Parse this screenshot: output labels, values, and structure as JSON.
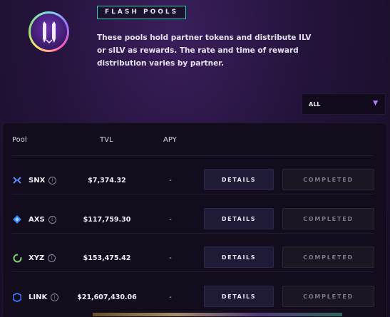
{
  "header": {
    "badge": "FLASH POOLS",
    "description": "These pools hold partner tokens and distribute ILV or sILV as rewards. The rate and time of reward distribution varies by partner."
  },
  "filter": {
    "selected": "ALL"
  },
  "table": {
    "columns": {
      "pool": "Pool",
      "tvl": "TVL",
      "apy": "APY"
    },
    "rows": [
      {
        "token": "SNX",
        "tvl": "$7,374.32",
        "apy": "-",
        "details_label": "DETAILS",
        "status_label": "COMPLETED",
        "icon": "snx-icon",
        "color": "#4f8cff"
      },
      {
        "token": "AXS",
        "tvl": "$117,759.30",
        "apy": "-",
        "details_label": "DETAILS",
        "status_label": "COMPLETED",
        "icon": "axs-icon",
        "color": "#3b82f6"
      },
      {
        "token": "XYZ",
        "tvl": "$153,475.42",
        "apy": "-",
        "details_label": "DETAILS",
        "status_label": "COMPLETED",
        "icon": "xyz-icon",
        "color": "#7fd86a"
      },
      {
        "token": "LINK",
        "tvl": "$21,607,430.06",
        "apy": "-",
        "details_label": "DETAILS",
        "status_label": "COMPLETED",
        "icon": "link-icon",
        "color": "#3a6cf0"
      }
    ]
  }
}
